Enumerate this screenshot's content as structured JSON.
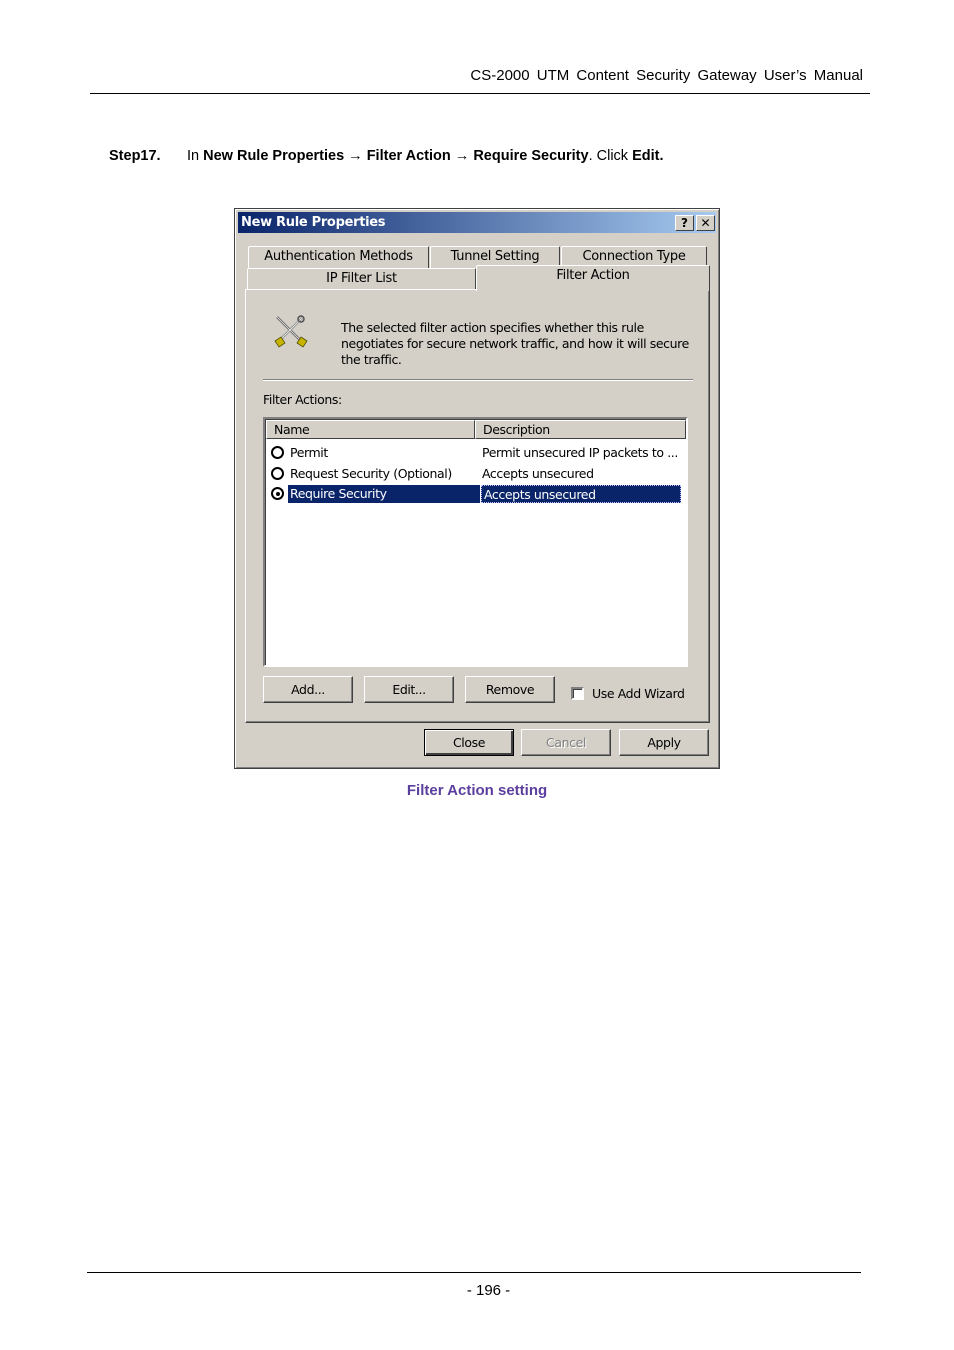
{
  "header": {
    "title": "CS-2000  UTM  Content  Security  Gateway  User’s  Manual"
  },
  "step": {
    "label": "Step17.",
    "in_text": "In ",
    "path1": "New Rule Properties",
    "arrow": " → ",
    "path2": "Filter Action",
    "path3": "Require Security",
    "click_text": ". Click ",
    "edit_text": "Edit."
  },
  "dialog": {
    "title": "New Rule Properties",
    "help_button": "?",
    "close_button": "✕",
    "tabs": {
      "authentication": "Authentication Methods",
      "tunnel": "Tunnel Setting",
      "connection": "Connection Type",
      "ip_filter": "IP Filter List",
      "filter_action": "Filter Action"
    },
    "intro_text": "The selected filter action specifies whether this rule negotiates for secure network traffic, and how it will secure the traffic.",
    "filter_actions_label": "Filter Actions:",
    "columns": {
      "name": "Name",
      "description": "Description"
    },
    "rows": [
      {
        "name": "Permit",
        "description": "Permit unsecured IP packets to ..."
      },
      {
        "name": "Request Security (Optional)",
        "description": "Accepts unsecured communicat..."
      },
      {
        "name": "Require Security",
        "description": "Accepts unsecured communicat..."
      }
    ],
    "selected_row": "Require Security",
    "buttons": {
      "add": "Add...",
      "edit": "Edit...",
      "remove": "Remove"
    },
    "use_add_wizard": {
      "label": "Use Add Wizard",
      "checked": false
    },
    "footer_buttons": {
      "close": "Close",
      "cancel": "Cancel",
      "apply": "Apply"
    },
    "colors": {
      "titlebar_start": "#0a246a",
      "titlebar_end": "#a6caf0",
      "selection": "#0a246a",
      "face": "#d4d0c8"
    }
  },
  "caption": "Filter Action setting",
  "page_number": "- 196 -"
}
